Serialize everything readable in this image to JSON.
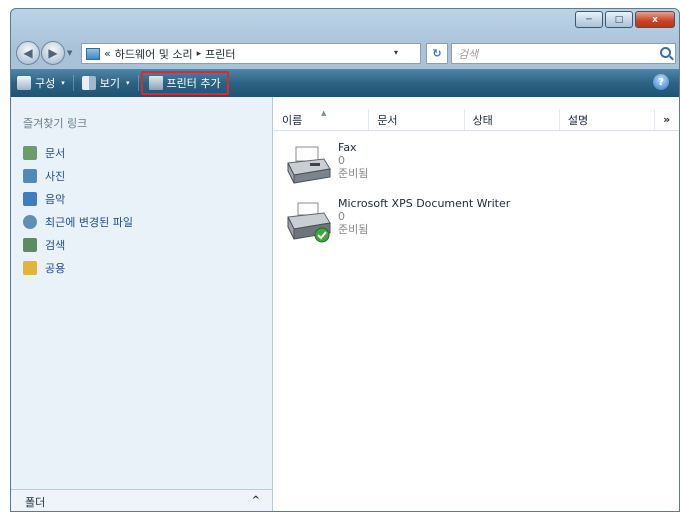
{
  "window": {
    "controls": [
      "─",
      "□",
      "x"
    ]
  },
  "address": {
    "overflow": "«",
    "crumbs": [
      "하드웨어 및 소리",
      "프린터"
    ],
    "separator": "▸",
    "dropdown": "▾",
    "refresh": "↻"
  },
  "search": {
    "placeholder": "검색"
  },
  "toolbar": {
    "organize": "구성",
    "view": "보기",
    "add_printer": "프린터 추가",
    "dropdown": "▾",
    "help": "?"
  },
  "navpane": {
    "title": "즐겨찾기 링크",
    "items": [
      {
        "label": "문서",
        "icon": "documents-icon",
        "color": "#6b9c6b"
      },
      {
        "label": "사진",
        "icon": "pictures-icon",
        "color": "#4f8bb8"
      },
      {
        "label": "음악",
        "icon": "music-icon",
        "color": "#3f7dc2"
      },
      {
        "label": "최근에 변경된 파일",
        "icon": "recent-files-icon",
        "color": "#5e8fb5"
      },
      {
        "label": "검색",
        "icon": "search-folder-icon",
        "color": "#5d8a63"
      },
      {
        "label": "공용",
        "icon": "public-folder-icon",
        "color": "#e1b43a"
      }
    ],
    "folders": "폴더",
    "folders_chevron": "^"
  },
  "columns": {
    "name": "이름",
    "docs": "문서",
    "status": "상태",
    "desc": "설명",
    "more": "»"
  },
  "printers": [
    {
      "name": "Fax",
      "docs": "0",
      "status": "준비됨",
      "icon": "fax-icon"
    },
    {
      "name": "Microsoft XPS Document Writer",
      "docs": "0",
      "status": "준비됨",
      "icon": "printer-default-icon"
    }
  ],
  "colors": {
    "toolbar": "#2d6283",
    "highlight": "#d92b2b",
    "link": "#1f4f86"
  }
}
